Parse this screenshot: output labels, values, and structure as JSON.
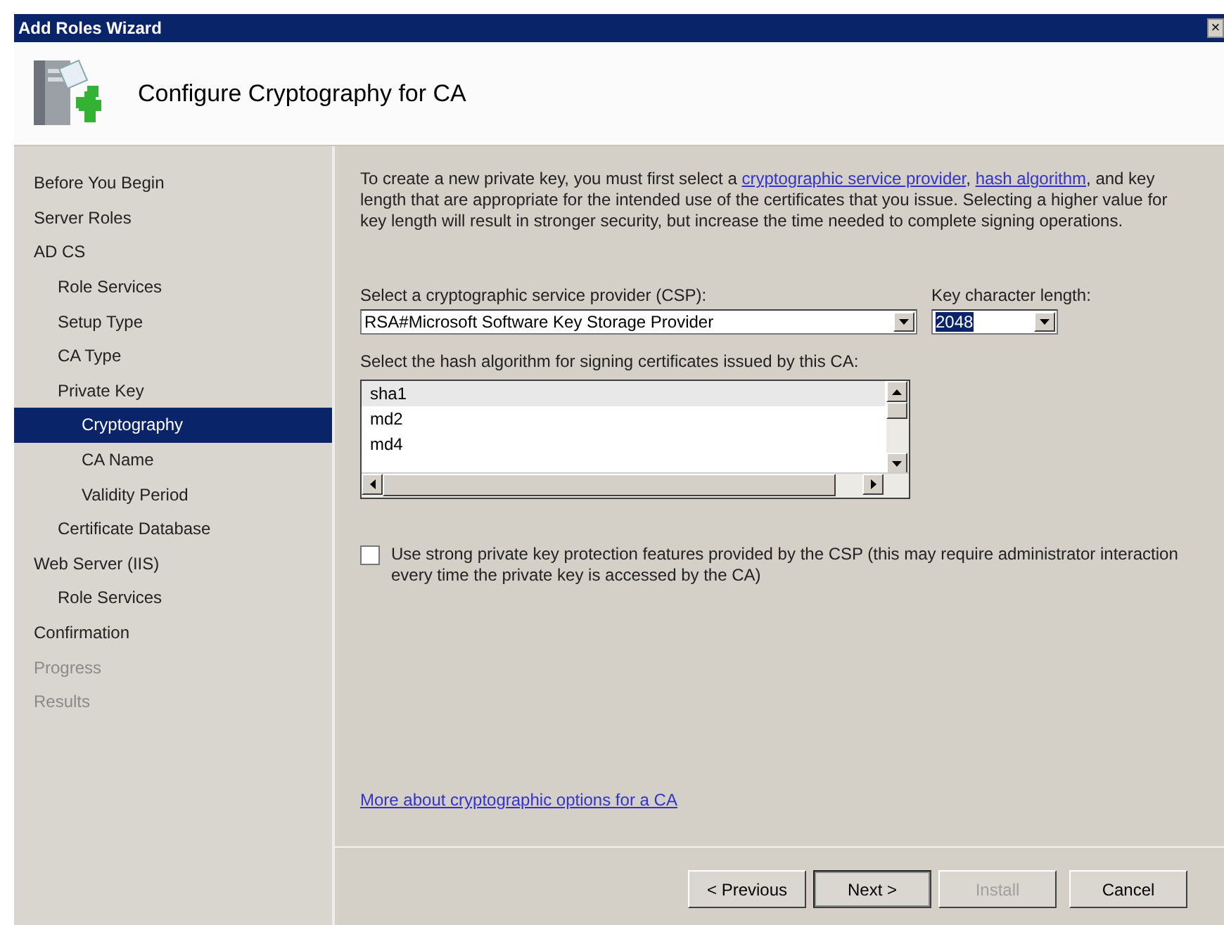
{
  "window": {
    "title": "Add Roles Wizard",
    "close": "×"
  },
  "header": {
    "title": "Configure Cryptography for CA"
  },
  "sidebar": {
    "items": [
      {
        "label": "Before You Begin",
        "selected": false,
        "disabled": false
      },
      {
        "label": "Server Roles",
        "selected": false,
        "disabled": false
      },
      {
        "label": "AD CS",
        "selected": false,
        "disabled": false,
        "children": [
          {
            "label": "Role Services",
            "selected": false,
            "disabled": false
          },
          {
            "label": "Setup Type",
            "selected": false,
            "disabled": false
          },
          {
            "label": "CA Type",
            "selected": false,
            "disabled": false
          },
          {
            "label": "Private Key",
            "selected": false,
            "disabled": false,
            "children": [
              {
                "label": "Cryptography",
                "selected": true,
                "disabled": false
              },
              {
                "label": "CA Name",
                "selected": false,
                "disabled": false
              },
              {
                "label": "Validity Period",
                "selected": false,
                "disabled": false
              }
            ]
          },
          {
            "label": "Certificate Database",
            "selected": false,
            "disabled": false
          }
        ]
      },
      {
        "label": "Web Server (IIS)",
        "selected": false,
        "disabled": false,
        "children": [
          {
            "label": "Role Services",
            "selected": false,
            "disabled": false
          }
        ]
      },
      {
        "label": "Confirmation",
        "selected": false,
        "disabled": false
      },
      {
        "label": "Progress",
        "selected": false,
        "disabled": true
      },
      {
        "label": "Results",
        "selected": false,
        "disabled": true
      }
    ]
  },
  "intro": [
    {
      "kind": "text",
      "text": "To create a new private key, you must first select a "
    },
    {
      "kind": "link",
      "text": "cryptographic service provider"
    },
    {
      "kind": "text",
      "text": ", "
    },
    {
      "kind": "link",
      "text": "hash algorithm"
    },
    {
      "kind": "text",
      "text": ", and key length that are appropriate for the intended use of the certificates that you issue. Selecting a higher value for key length will result in stronger security, but increase the time needed to complete signing operations."
    }
  ],
  "csp": {
    "label": "Select a cryptographic service provider (CSP):",
    "value": "RSA#Microsoft Software Key Storage Provider"
  },
  "key_length": {
    "label": "Key character length:",
    "value": "2048"
  },
  "hash": {
    "label": "Select the hash algorithm for signing certificates issued by this CA:",
    "items": [
      {
        "label": "sha1",
        "selected": true
      },
      {
        "label": "md2",
        "selected": false
      },
      {
        "label": "md4",
        "selected": false
      }
    ]
  },
  "strong_protection": {
    "label": "Use strong private key protection features provided by the CSP (this may require administrator interaction every time the private key is accessed by the CA)",
    "checked": false
  },
  "more_link": "More about cryptographic options for a CA",
  "buttons": [
    {
      "label": "< Previous",
      "disabled": false,
      "default": false
    },
    {
      "label": "Next >",
      "disabled": false,
      "default": true
    },
    {
      "label": "Install",
      "disabled": true,
      "default": false
    },
    {
      "label": "Cancel",
      "disabled": false,
      "default": false
    }
  ]
}
